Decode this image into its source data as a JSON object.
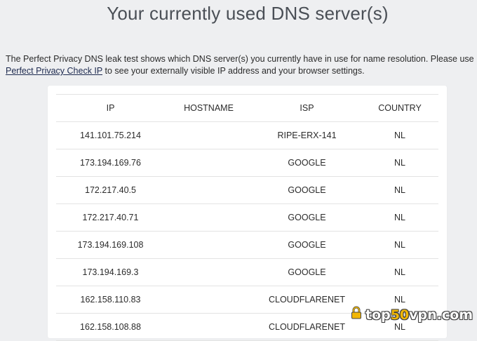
{
  "page": {
    "title": "Your currently used DNS server(s)",
    "intro_text": "The Perfect Privacy DNS leak test shows which DNS server(s) you currently have in use for name resolution. Please use ",
    "intro_link": "Perfect Privacy Check IP",
    "intro_text_after": " to see your externally visible IP address and your browser settings."
  },
  "table": {
    "headers": {
      "ip": "IP",
      "hostname": "HOSTNAME",
      "isp": "ISP",
      "country": "COUNTRY"
    },
    "rows": [
      {
        "ip": "141.101.75.214",
        "hostname": "",
        "isp": "RIPE-ERX-141",
        "country": "NL"
      },
      {
        "ip": "173.194.169.76",
        "hostname": "",
        "isp": "GOOGLE",
        "country": "NL"
      },
      {
        "ip": "172.217.40.5",
        "hostname": "",
        "isp": "GOOGLE",
        "country": "NL"
      },
      {
        "ip": "172.217.40.71",
        "hostname": "",
        "isp": "GOOGLE",
        "country": "NL"
      },
      {
        "ip": "173.194.169.108",
        "hostname": "",
        "isp": "GOOGLE",
        "country": "NL"
      },
      {
        "ip": "173.194.169.3",
        "hostname": "",
        "isp": "GOOGLE",
        "country": "NL"
      },
      {
        "ip": "162.158.110.83",
        "hostname": "",
        "isp": "CLOUDFLARENET",
        "country": "NL"
      },
      {
        "ip": "162.158.108.88",
        "hostname": "",
        "isp": "CLOUDFLARENET",
        "country": "NL"
      }
    ]
  },
  "watermark": {
    "brand_pre": "top",
    "brand_accent": "50",
    "brand_post": "vpn.com",
    "icon": "lock-icon"
  },
  "colors": {
    "background": "#eeeff1",
    "link": "#1d2a4f",
    "accent": "#f2b705"
  }
}
